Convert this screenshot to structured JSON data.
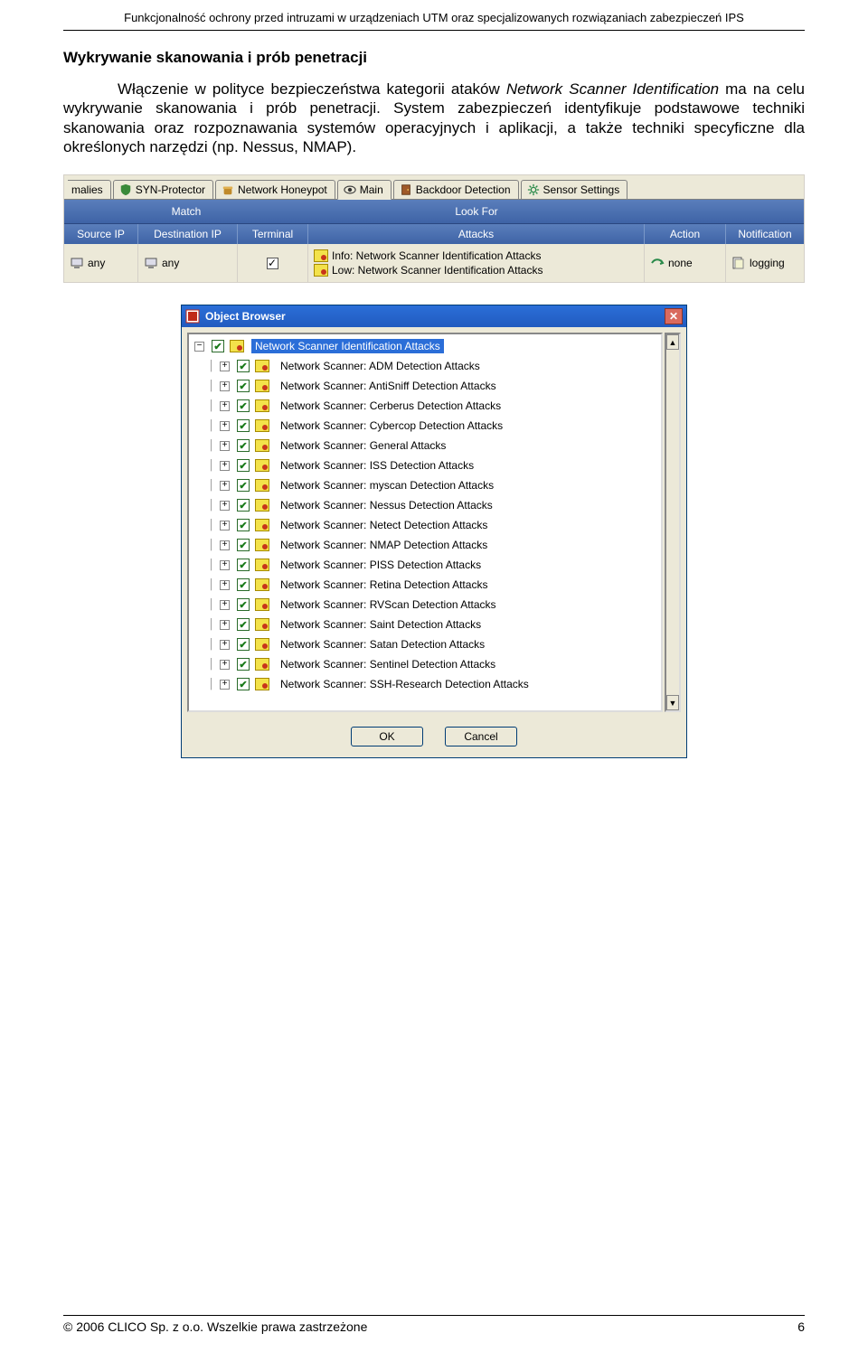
{
  "doc": {
    "header": "Funkcjonalność ochrony przed intruzami w urządzeniach UTM oraz specjalizowanych rozwiązaniach zabezpieczeń IPS",
    "section_title": "Wykrywanie skanowania i prób penetracji",
    "paragraph_lead": "Włączenie w polityce bezpieczeństwa kategorii ataków ",
    "paragraph_italic": "Network Scanner Identification",
    "paragraph_tail": " ma na celu wykrywanie skanowania i prób penetracji. System zabezpieczeń identyfikuje podstawowe techniki skanowania oraz rozpoznawania systemów operacyjnych i aplikacji, a także techniki specyficzne dla określonych narzędzi (np. Nessus, NMAP).",
    "footer_left": "© 2006 CLICO Sp. z o.o. Wszelkie prawa zastrzeżone",
    "footer_right": "6"
  },
  "tabs": {
    "t0": "malies",
    "t1": "SYN-Protector",
    "t2": "Network Honeypot",
    "t3": "Main",
    "t4": "Backdoor Detection",
    "t5": "Sensor Settings"
  },
  "grid": {
    "match": "Match",
    "look": "Look For",
    "src": "Source IP",
    "dst": "Destination IP",
    "term": "Terminal",
    "att": "Attacks",
    "act": "Action",
    "notif": "Notification",
    "any1": "any",
    "any2": "any",
    "attack1": "Info: Network Scanner Identification Attacks",
    "attack2": "Low: Network Scanner Identification Attacks",
    "action_val": "none",
    "notif_val": "logging"
  },
  "ob": {
    "title": "Object Browser",
    "ok": "OK",
    "cancel": "Cancel",
    "items": [
      "Network Scanner Identification Attacks",
      "Network Scanner: ADM Detection Attacks",
      "Network Scanner: AntiSniff Detection Attacks",
      "Network Scanner: Cerberus Detection Attacks",
      "Network Scanner: Cybercop Detection Attacks",
      "Network Scanner: General Attacks",
      "Network Scanner: ISS Detection Attacks",
      "Network Scanner: myscan Detection Attacks",
      "Network Scanner: Nessus Detection Attacks",
      "Network Scanner: Netect Detection Attacks",
      "Network Scanner: NMAP Detection Attacks",
      "Network Scanner: PISS Detection Attacks",
      "Network Scanner: Retina Detection Attacks",
      "Network Scanner: RVScan Detection Attacks",
      "Network Scanner: Saint Detection Attacks",
      "Network Scanner: Satan Detection Attacks",
      "Network Scanner: Sentinel Detection Attacks",
      "Network Scanner: SSH-Research Detection Attacks"
    ]
  }
}
